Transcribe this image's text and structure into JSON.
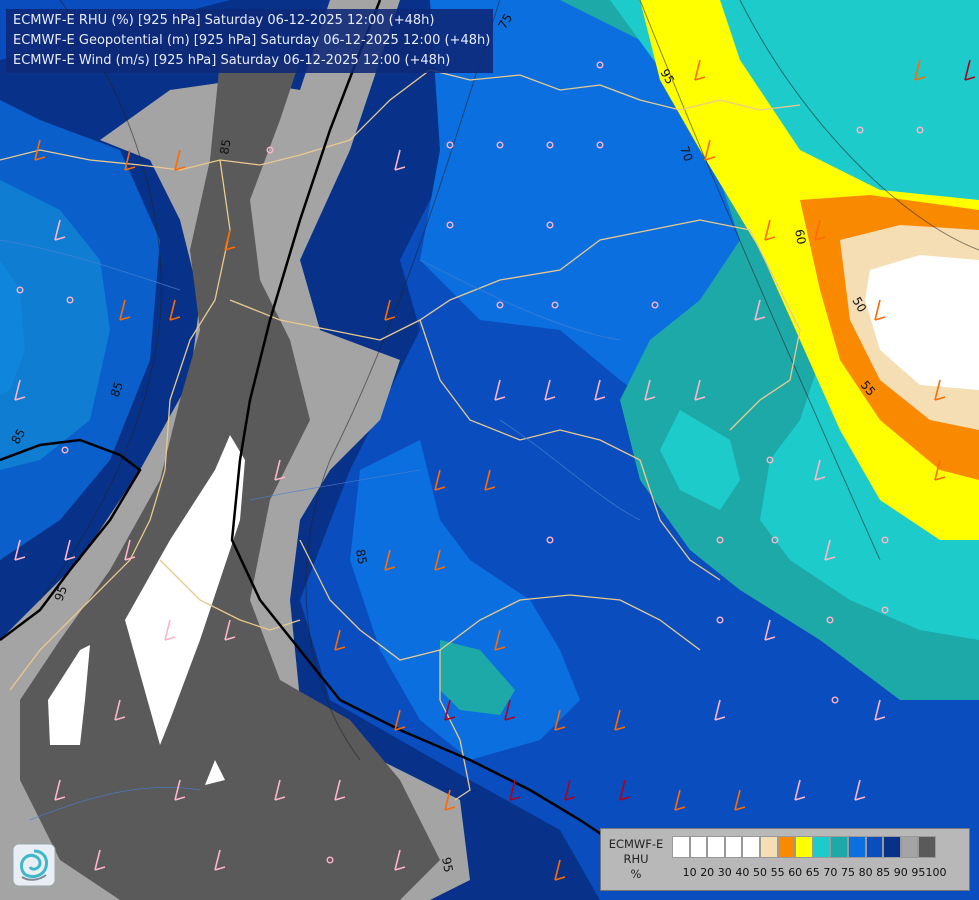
{
  "header": {
    "lines": [
      "ECMWF-E RHU (%) [925 hPa] Saturday 06-12-2025 12:00 (+48h)",
      "ECMWF-E Geopotential (m) [925 hPa] Saturday 06-12-2025 12:00 (+48h)",
      "ECMWF-E Wind (m/s) [925 hPa] Saturday 06-12-2025 12:00 (+48h)"
    ]
  },
  "legend": {
    "title_line1": "ECMWF-E",
    "title_line2": "RHU",
    "unit": "%",
    "ticks": [
      "10",
      "20",
      "30",
      "40",
      "50",
      "55",
      "60",
      "65",
      "70",
      "75",
      "80",
      "85",
      "90",
      "95",
      "100"
    ],
    "colors": [
      "#ffffff",
      "#ffffff",
      "#ffffff",
      "#ffffff",
      "#ffffff",
      "#f5deb3",
      "#f98a00",
      "#ffff00",
      "#1ecbcb",
      "#1ea9a9",
      "#0b6fe0",
      "#0a4dbf",
      "#08328a",
      "#a4a4a4",
      "#5a5a5a"
    ]
  },
  "contour_labels": [
    "75",
    "85",
    "95",
    "70",
    "60",
    "50",
    "55",
    "85",
    "85",
    "95",
    "95",
    "85"
  ],
  "colors": {
    "yellow": "#ffff00",
    "orange": "#f98a00",
    "wheat": "#f5deb3",
    "cyan": "#1ecbcb",
    "teal": "#1ea9a9",
    "blue_light": "#0b6fe0",
    "blue_mid": "#0a4dbf",
    "blue_dark": "#08328a",
    "gray_light": "#a4a4a4",
    "gray_dark": "#5a5a5a",
    "border": "#e8c98e"
  }
}
